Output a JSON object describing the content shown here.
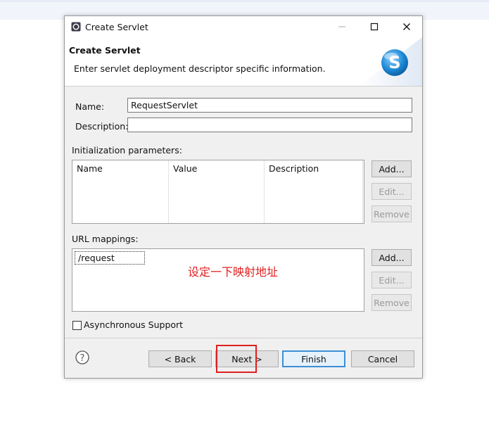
{
  "window": {
    "title": "Create Servlet",
    "controls": {
      "minimize": "minimize-icon",
      "maximize": "maximize-icon",
      "close": "close-icon"
    }
  },
  "header": {
    "title": "Create Servlet",
    "description": "Enter servlet deployment descriptor specific information.",
    "banner_icon": "servlet-s-icon"
  },
  "form": {
    "name_label": "Name:",
    "name_value": "RequestServlet",
    "description_label": "Description:",
    "description_value": ""
  },
  "init_params": {
    "label": "Initialization parameters:",
    "columns": [
      "Name",
      "Value",
      "Description"
    ],
    "rows": [],
    "add_label": "Add...",
    "edit_label": "Edit...",
    "remove_label": "Remove"
  },
  "url_mappings": {
    "label": "URL mappings:",
    "items": [
      "/request"
    ],
    "add_label": "Add...",
    "edit_label": "Edit...",
    "remove_label": "Remove",
    "annotation": "设定一下映射地址"
  },
  "async": {
    "label": "Asynchronous Support",
    "checked": false
  },
  "footer": {
    "help_icon": "help-icon",
    "back_label": "< Back",
    "next_label": "Next >",
    "finish_label": "Finish",
    "cancel_label": "Cancel"
  },
  "colors": {
    "annotation": "#e02020",
    "default_button_border": "#3c8fd6",
    "banner_blue": "#1e8ad6"
  }
}
